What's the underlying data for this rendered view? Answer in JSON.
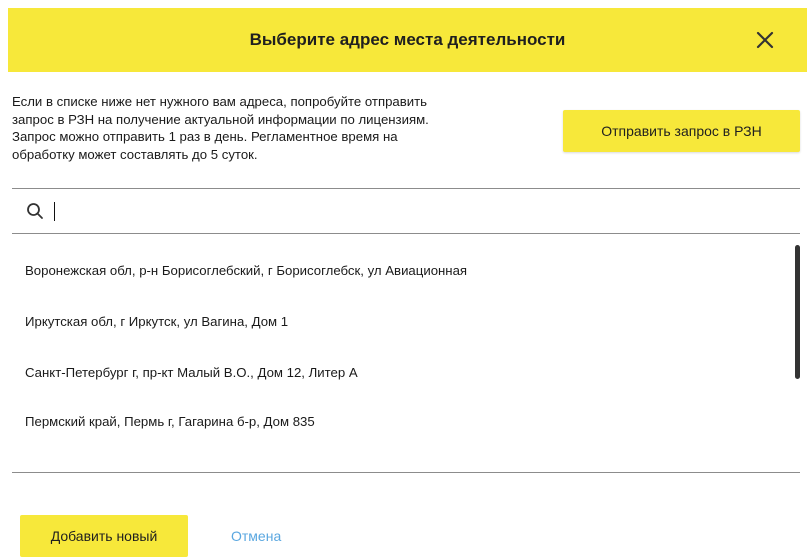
{
  "dialog": {
    "title": "Выберите адрес места деятельности",
    "close_icon": "close-icon",
    "info_lines": [
      "Если в списке ниже нет нужного вам адреса, попробуйте отправить",
      "запрос в РЗН на получение актуальной информации по лицензиям.",
      "Запрос можно отправить 1 раз в день. Регламентное время на",
      "обработку может составлять до 5 суток."
    ],
    "send_request_label": "Отправить запрос в РЗН"
  },
  "search": {
    "value": "",
    "placeholder": "",
    "icon": "search-icon"
  },
  "addresses": [
    "Воронежская обл, р-н Борисоглебский, г Борисоглебск, ул Авиационная",
    "Иркутская обл, г Иркутск, ул Вагина, Дом 1",
    "Санкт-Петербург г, пр-кт Малый В.О., Дом 12, Литер А",
    "Пермский край, Пермь г, Гагарина б-р, Дом 835"
  ],
  "footer": {
    "add_new_label": "Добавить новый",
    "cancel_label": "Отмена"
  },
  "colors": {
    "accent": "#f7e83a",
    "link": "#5aa7e0"
  }
}
